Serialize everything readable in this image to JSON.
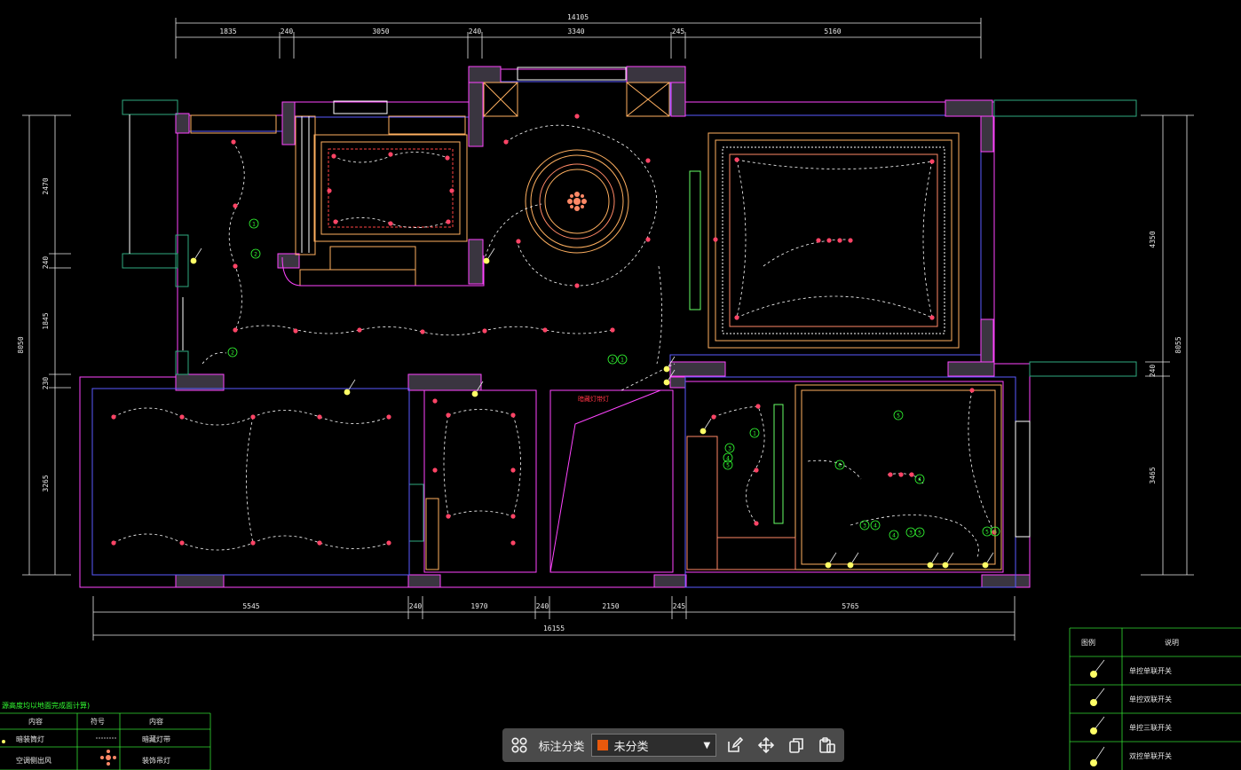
{
  "drawing": {
    "dims_top": {
      "total": "14105",
      "segments": [
        "1835",
        "240",
        "3050",
        "240",
        "3340",
        "245",
        "5160"
      ]
    },
    "dims_bottom": {
      "total": "16155",
      "segments": [
        "5545",
        "240",
        "1970",
        "240",
        "2150",
        "245",
        "5765"
      ]
    },
    "dims_left": {
      "total": "8050",
      "segments": [
        "2470",
        "240",
        "1845",
        "230",
        "3265"
      ]
    },
    "dims_right": {
      "total": "8055",
      "segments": [
        "4350",
        "240",
        "3465"
      ]
    },
    "room_note": "暗藏灯带灯",
    "legend_left": {
      "title": "源高度均以地面完成面计算)",
      "headers": [
        "内容",
        "符号",
        "内容"
      ],
      "rows": [
        {
          "c1": "暗装筒灯",
          "c3": "暗藏灯带"
        },
        {
          "c1": "空调侧出风",
          "c3": "装饰吊灯"
        }
      ]
    },
    "legend_right": {
      "headers": [
        "图例",
        "说明"
      ],
      "rows": [
        "单控单联开关",
        "单控双联开关",
        "单控三联开关",
        "双控单联开关"
      ]
    },
    "circle_markers": [
      "1",
      "2",
      "3",
      "4",
      "5",
      "6"
    ]
  },
  "toolbar": {
    "category_label": "标注分类",
    "selected_category": "未分类",
    "selected_color": "#e8590c",
    "icons": [
      "grid-icon",
      "edit-icon",
      "move-icon",
      "copy-icon",
      "paste-icon"
    ]
  }
}
